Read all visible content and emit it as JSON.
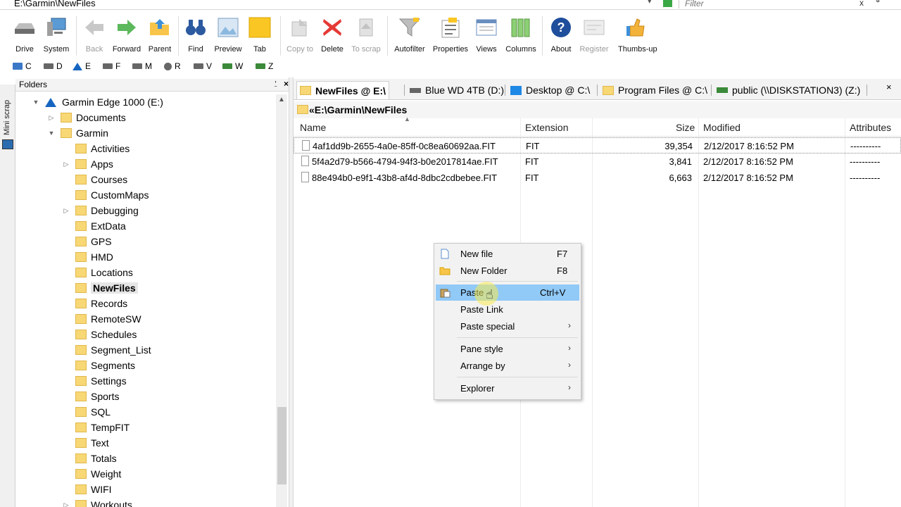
{
  "address": {
    "path": "E:\\Garmin\\NewFiles",
    "filter_placeholder": "Filter",
    "clear_label": "x"
  },
  "toolbar": {
    "buttons": [
      {
        "label": "Drive",
        "icon": "drive-icon"
      },
      {
        "label": "System",
        "icon": "computer-icon"
      },
      {
        "label": "Back",
        "icon": "back-arrow-icon"
      },
      {
        "label": "Forward",
        "icon": "forward-arrow-icon"
      },
      {
        "label": "Parent",
        "icon": "parent-folder-icon"
      },
      {
        "label": "Find",
        "icon": "binoculars-icon"
      },
      {
        "label": "Preview",
        "icon": "preview-icon"
      },
      {
        "label": "Tab",
        "icon": "tab-folder-icon"
      },
      {
        "label": "Copy to",
        "icon": "copy-to-icon"
      },
      {
        "label": "Delete",
        "icon": "delete-x-icon"
      },
      {
        "label": "To scrap",
        "icon": "to-scrap-icon"
      },
      {
        "label": "Autofilter",
        "icon": "funnel-icon"
      },
      {
        "label": "Properties",
        "icon": "properties-icon"
      },
      {
        "label": "Views",
        "icon": "views-icon"
      },
      {
        "label": "Columns",
        "icon": "columns-icon"
      },
      {
        "label": "About",
        "icon": "help-icon"
      },
      {
        "label": "Register",
        "icon": "register-icon"
      },
      {
        "label": "Thumbs-up",
        "icon": "thumbs-up-icon"
      }
    ]
  },
  "drives": [
    "C",
    "D",
    "E",
    "F",
    "M",
    "R",
    "V",
    "W",
    "Z"
  ],
  "mini_scrap_label": "Mini scrap",
  "folders_panel": {
    "title": "Folders",
    "pin_glyph": "⍘",
    "close_glyph": "×",
    "root": "Garmin Edge 1000 (E:)",
    "items": [
      "Documents",
      "Garmin",
      "Activities",
      "Apps",
      "Courses",
      "CustomMaps",
      "Debugging",
      "ExtData",
      "GPS",
      "HMD",
      "Locations",
      "NewFiles",
      "Records",
      "RemoteSW",
      "Schedules",
      "Segment_List",
      "Segments",
      "Settings",
      "Sports",
      "SQL",
      "TempFIT",
      "Text",
      "Totals",
      "Weight",
      "WIFI",
      "Workouts"
    ]
  },
  "tabs": [
    {
      "label": "NewFiles @ E:\\"
    },
    {
      "label": "Blue WD 4TB (D:)"
    },
    {
      "label": "Desktop @ C:\\"
    },
    {
      "label": "Program Files @ C:\\"
    },
    {
      "label": "public (\\\\DISKSTATION3) (Z:)"
    }
  ],
  "path_bar": "«E:\\Garmin\\NewFiles",
  "list": {
    "columns": [
      "Name",
      "Extension",
      "Size",
      "Modified",
      "Attributes"
    ],
    "rows": [
      {
        "name": "4af1dd9b-2655-4a0e-85ff-0c8ea60692aa.FIT",
        "ext": "FIT",
        "size": "39,354",
        "modified": "2/12/2017 8:16:52 PM",
        "attr": "----------"
      },
      {
        "name": "5f4a2d79-b566-4794-94f3-b0e2017814ae.FIT",
        "ext": "FIT",
        "size": "3,841",
        "modified": "2/12/2017 8:16:52 PM",
        "attr": "----------"
      },
      {
        "name": "88e494b0-e9f1-43b8-af4d-8dbc2cdbebee.FIT",
        "ext": "FIT",
        "size": "6,663",
        "modified": "2/12/2017 8:16:52 PM",
        "attr": "----------"
      }
    ]
  },
  "context_menu": {
    "items": [
      {
        "label": "New file",
        "shortcut": "F7"
      },
      {
        "label": "New Folder",
        "shortcut": "F8"
      },
      {
        "label": "Paste",
        "shortcut": "Ctrl+V"
      },
      {
        "label": "Paste Link"
      },
      {
        "label": "Paste special"
      },
      {
        "label": "Pane style"
      },
      {
        "label": "Arrange by"
      },
      {
        "label": "Explorer"
      }
    ],
    "submenu_glyph": "›"
  },
  "colors": {
    "highlight": "#91c9f7",
    "folder": "#f8d775",
    "drive_accent": "#1565c0",
    "delete_red": "#e53935",
    "forward_green": "#5cb85c"
  }
}
